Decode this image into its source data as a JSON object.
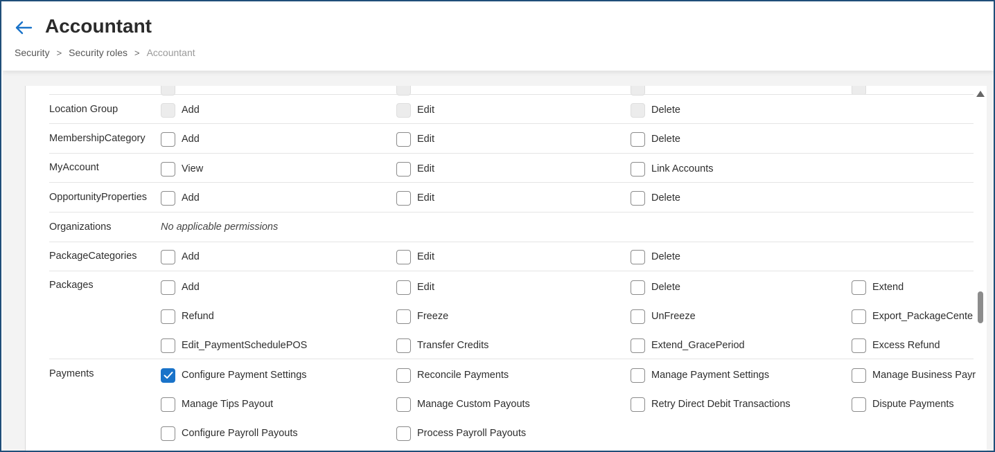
{
  "header": {
    "title": "Accountant",
    "breadcrumb": [
      "Security",
      "Security roles",
      "Accountant"
    ],
    "separator": ">"
  },
  "accent_color": "#1a73c9",
  "no_permissions_text": "No applicable permissions",
  "rows": [
    {
      "name": "",
      "perms": [
        [
          "",
          "disabled"
        ],
        [
          "",
          "disabled"
        ],
        [
          "",
          "disabled"
        ],
        [
          "",
          "disabled"
        ]
      ]
    },
    {
      "name": "Location Group",
      "perms": [
        [
          "Add",
          "disabled"
        ],
        [
          "Edit",
          "disabled"
        ],
        [
          "Delete",
          "disabled"
        ]
      ]
    },
    {
      "name": "MembershipCategory",
      "perms": [
        [
          "Add",
          "unchecked"
        ],
        [
          "Edit",
          "unchecked"
        ],
        [
          "Delete",
          "unchecked"
        ]
      ]
    },
    {
      "name": "MyAccount",
      "perms": [
        [
          "View",
          "unchecked"
        ],
        [
          "Edit",
          "unchecked"
        ],
        [
          "Link Accounts",
          "unchecked"
        ]
      ]
    },
    {
      "name": "OpportunityProperties",
      "perms": [
        [
          "Add",
          "unchecked"
        ],
        [
          "Edit",
          "unchecked"
        ],
        [
          "Delete",
          "unchecked"
        ]
      ]
    },
    {
      "name": "Organizations",
      "none": true,
      "perms": []
    },
    {
      "name": "PackageCategories",
      "perms": [
        [
          "Add",
          "unchecked"
        ],
        [
          "Edit",
          "unchecked"
        ],
        [
          "Delete",
          "unchecked"
        ]
      ]
    },
    {
      "name": "Packages",
      "perms": [
        [
          "Add",
          "unchecked"
        ],
        [
          "Edit",
          "unchecked"
        ],
        [
          "Delete",
          "unchecked"
        ],
        [
          "Extend",
          "unchecked"
        ],
        [
          "Refund",
          "unchecked"
        ],
        [
          "Freeze",
          "unchecked"
        ],
        [
          "UnFreeze",
          "unchecked"
        ],
        [
          "Export_PackageCente",
          "unchecked"
        ],
        [
          "Edit_PaymentSchedulePOS",
          "unchecked"
        ],
        [
          "Transfer Credits",
          "unchecked"
        ],
        [
          "Extend_GracePeriod",
          "unchecked"
        ],
        [
          "Excess Refund",
          "unchecked"
        ]
      ]
    },
    {
      "name": "Payments",
      "perms": [
        [
          "Configure Payment Settings",
          "checked"
        ],
        [
          "Reconcile Payments",
          "unchecked"
        ],
        [
          "Manage Payment Settings",
          "unchecked"
        ],
        [
          "Manage Business Payr",
          "unchecked"
        ],
        [
          "Manage Tips Payout",
          "unchecked"
        ],
        [
          "Manage Custom Payouts",
          "unchecked"
        ],
        [
          "Retry Direct Debit Transactions",
          "unchecked"
        ],
        [
          "Dispute Payments",
          "unchecked"
        ],
        [
          "Configure Payroll Payouts",
          "unchecked"
        ],
        [
          "Process Payroll Payouts",
          "unchecked"
        ]
      ]
    }
  ]
}
